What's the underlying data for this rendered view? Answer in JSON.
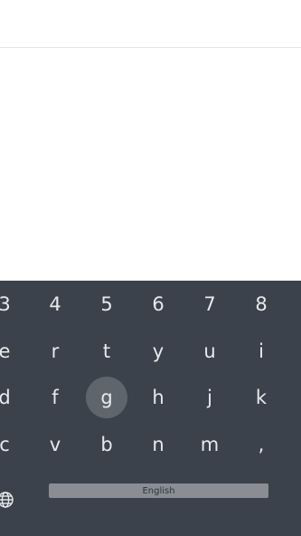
{
  "keyboard": {
    "row1": [
      "3",
      "4",
      "5",
      "6",
      "7",
      "8"
    ],
    "row2": [
      "e",
      "r",
      "t",
      "y",
      "u",
      "i"
    ],
    "row3": [
      "d",
      "f",
      "g",
      "h",
      "j",
      "k"
    ],
    "row4": [
      "c",
      "v",
      "b",
      "n",
      "m",
      ","
    ],
    "pressed_key": "g",
    "space_label": "English",
    "colors": {
      "background": "#3c424b",
      "key_text": "#e7e9ec",
      "pressed": "#5f656d",
      "spacebar": "#8a8e94"
    },
    "icons": {
      "language": "globe-icon"
    }
  }
}
